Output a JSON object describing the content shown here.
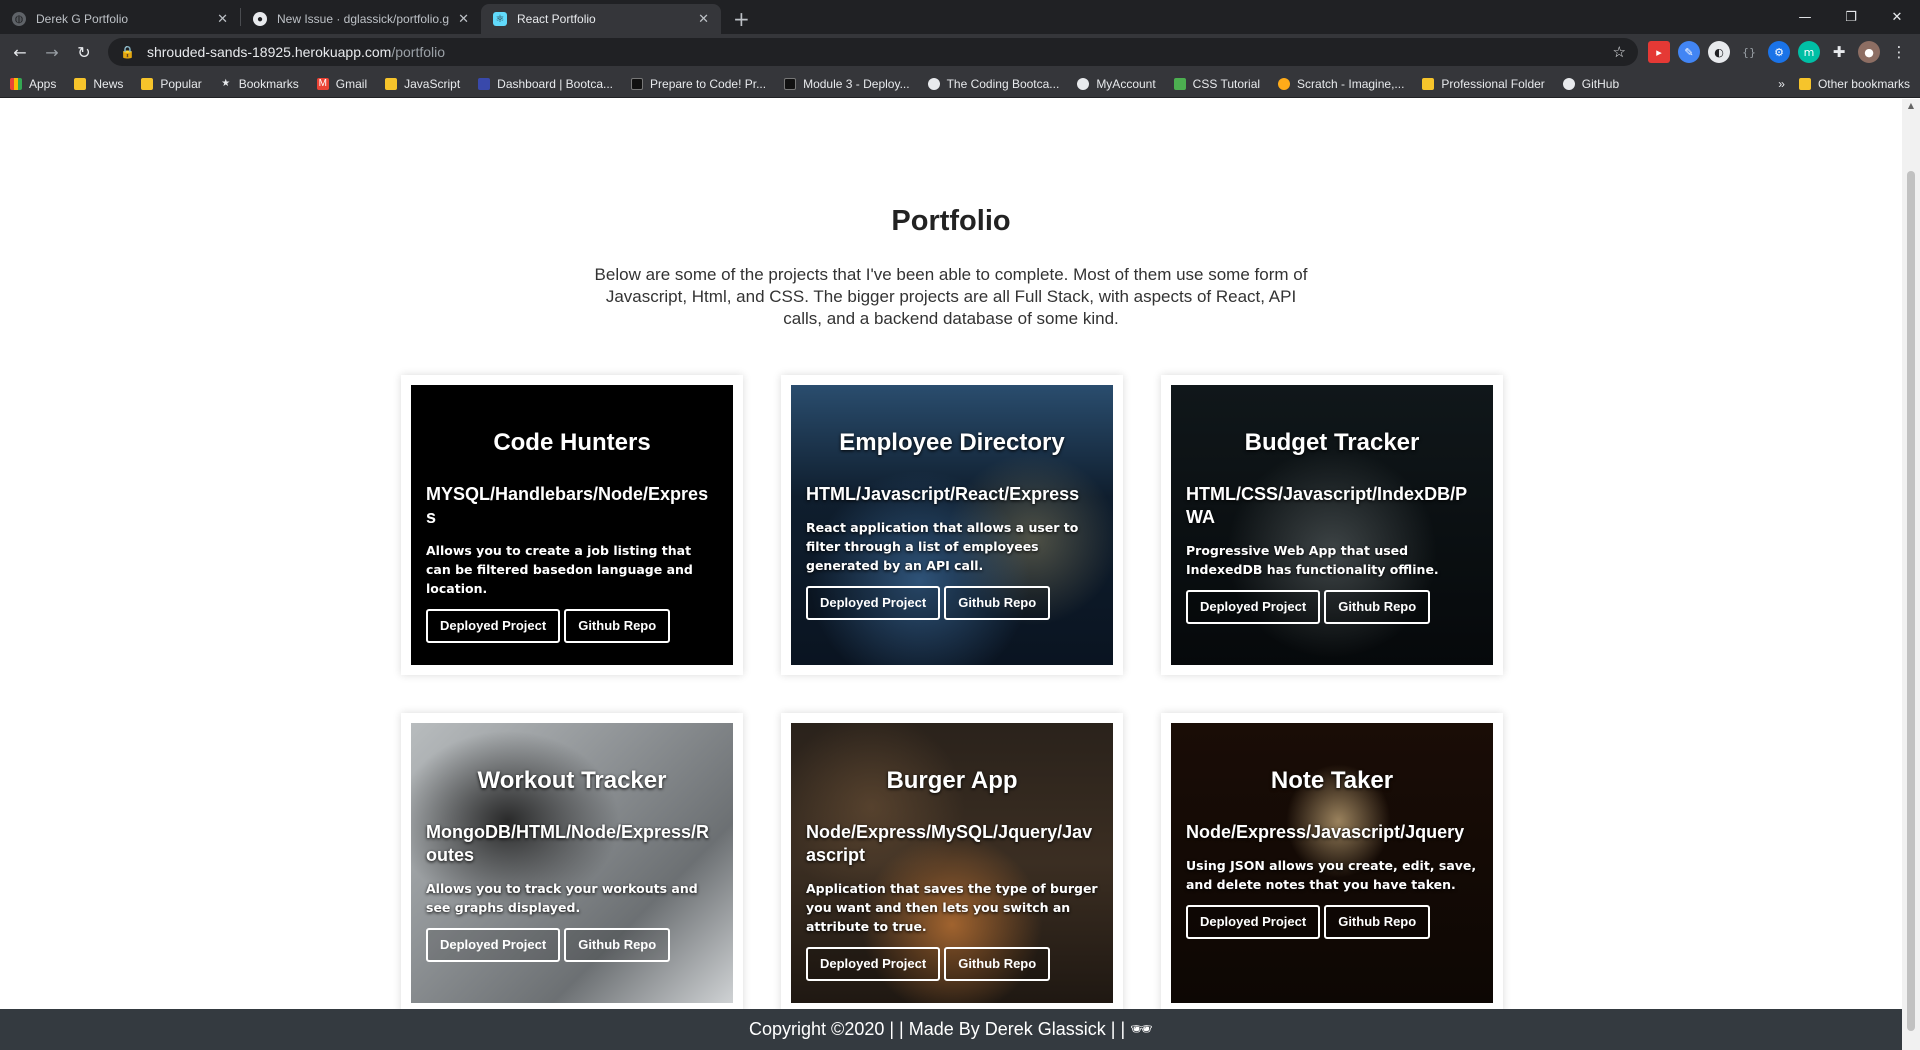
{
  "tabs": [
    {
      "title": "Derek G Portfolio",
      "icon": "globe-icon"
    },
    {
      "title": "New Issue · dglassick/portfolio.g",
      "icon": "github-icon"
    },
    {
      "title": "React Portfolio",
      "icon": "react-icon",
      "active": true
    }
  ],
  "address": {
    "domain": "shrouded-sands-18925.herokuapp.com",
    "path": "/portfolio"
  },
  "bookmarks": [
    {
      "label": "Apps",
      "icon": "apps-grid-icon"
    },
    {
      "label": "News",
      "icon": "folder-icon"
    },
    {
      "label": "Popular",
      "icon": "folder-icon"
    },
    {
      "label": "Bookmarks",
      "icon": "star-icon"
    },
    {
      "label": "Gmail",
      "icon": "gmail-icon"
    },
    {
      "label": "JavaScript",
      "icon": "folder-icon"
    },
    {
      "label": "Dashboard | Bootca...",
      "icon": "shield-icon"
    },
    {
      "label": "Prepare to Code! Pr...",
      "icon": "book-icon"
    },
    {
      "label": "Module 3 - Deploy...",
      "icon": "book-icon"
    },
    {
      "label": "The Coding Bootca...",
      "icon": "github-icon"
    },
    {
      "label": "MyAccount",
      "icon": "globe-icon"
    },
    {
      "label": "CSS Tutorial",
      "icon": "w3-icon"
    },
    {
      "label": "Scratch - Imagine,...",
      "icon": "scratch-icon"
    },
    {
      "label": "Professional Folder",
      "icon": "folder-icon"
    },
    {
      "label": "GitHub",
      "icon": "github-icon"
    }
  ],
  "bookmarks_overflow": "»",
  "other_bookmarks": "Other bookmarks",
  "page": {
    "title": "Portfolio",
    "intro": "Below are some of the projects that I've been able to complete. Most of them use some form of Javascript, Html, and CSS. The bigger projects are all Full Stack, with aspects of React, API calls, and a backend database of some kind."
  },
  "projects": [
    {
      "name": "Code Hunters",
      "stack": "MYSQL/Handlebars/Node/Express",
      "description": "Allows you to create a job listing that can be filtered basedon language and location.",
      "deployed_label": "Deployed Project",
      "repo_label": "Github Repo"
    },
    {
      "name": "Employee Directory",
      "stack": "HTML/Javascript/React/Express",
      "description": "React application that allows a user to filter through a list of employees generated by an API call.",
      "deployed_label": "Deployed Project",
      "repo_label": "Github Repo"
    },
    {
      "name": "Budget Tracker",
      "stack": "HTML/CSS/Javascript/IndexDB/PWA",
      "description": "Progressive Web App that used IndexedDB has functionality offline.",
      "deployed_label": "Deployed Project",
      "repo_label": "Github Repo"
    },
    {
      "name": "Workout Tracker",
      "stack": "MongoDB/HTML/Node/Express/Routes",
      "description": "Allows you to track your workouts and see graphs displayed.",
      "deployed_label": "Deployed Project",
      "repo_label": "Github Repo"
    },
    {
      "name": "Burger App",
      "stack": "Node/Express/MySQL/Jquery/Javascript",
      "description": "Application that saves the type of burger you want and then lets you switch an attribute to true.",
      "deployed_label": "Deployed Project",
      "repo_label": "Github Repo"
    },
    {
      "name": "Note Taker",
      "stack": "Node/Express/Javascript/Jquery",
      "description": "Using JSON allows you create, edit, save, and delete notes that you have taken.",
      "deployed_label": "Deployed Project",
      "repo_label": "Github Repo"
    }
  ],
  "footer": {
    "text": "Copyright ©2020 | | Made By Derek Glassick | | 🕶",
    "icon": "glasses-icon"
  },
  "colors": {
    "chrome_dark": "#202124",
    "chrome_toolbar": "#35363a",
    "footer_bg": "#343a40"
  }
}
